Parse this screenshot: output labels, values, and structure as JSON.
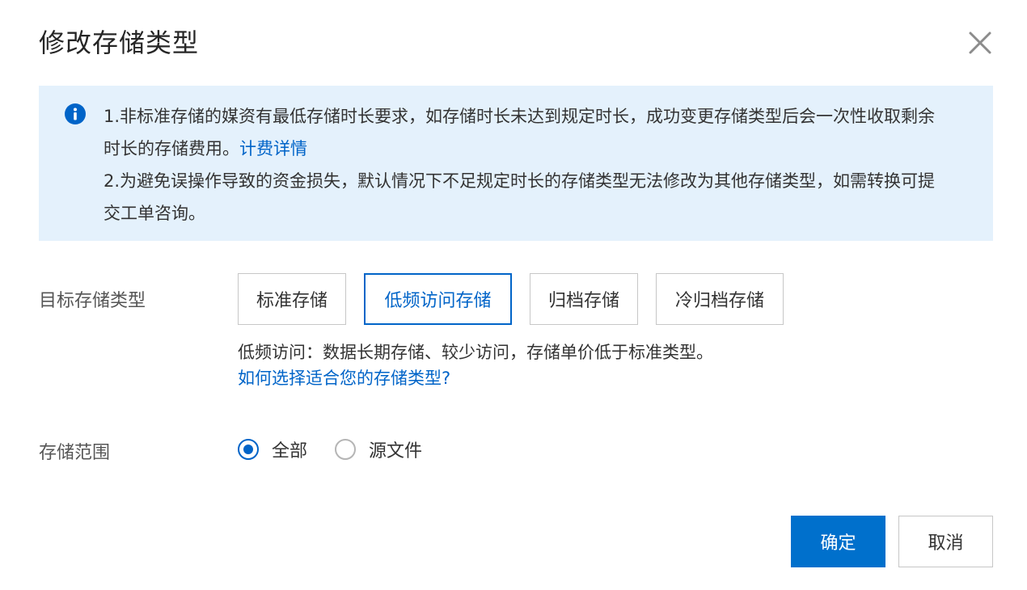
{
  "dialog": {
    "title": "修改存储类型",
    "close_icon": "close-icon"
  },
  "notice": {
    "icon": "info-icon",
    "line1": "1.非标准存储的媒资有最低存储时长要求，如存储时长未达到规定时长，成功变更存储类型后会一次性收取剩余时长的存储费用。",
    "line1_link": "计费详情",
    "line2": "2.为避免误操作导致的资金损失，默认情况下不足规定时长的存储类型无法修改为其他存储类型，如需转换可提交工单咨询。"
  },
  "storage_type": {
    "label": "目标存储类型",
    "options": [
      "标准存储",
      "低频访问存储",
      "归档存储",
      "冷归档存储"
    ],
    "selected": "低频访问存储",
    "description": "低频访问：数据长期存储、较少访问，存储单价低于标准类型。",
    "help_link": "如何选择适合您的存储类型?"
  },
  "storage_scope": {
    "label": "存储范围",
    "options": [
      "全部",
      "源文件"
    ],
    "selected": "全部"
  },
  "footer": {
    "confirm_label": "确定",
    "cancel_label": "取消"
  },
  "colors": {
    "accent": "#0064c8",
    "primary_button": "#0070cc",
    "notice_background": "#e4f1fc"
  }
}
